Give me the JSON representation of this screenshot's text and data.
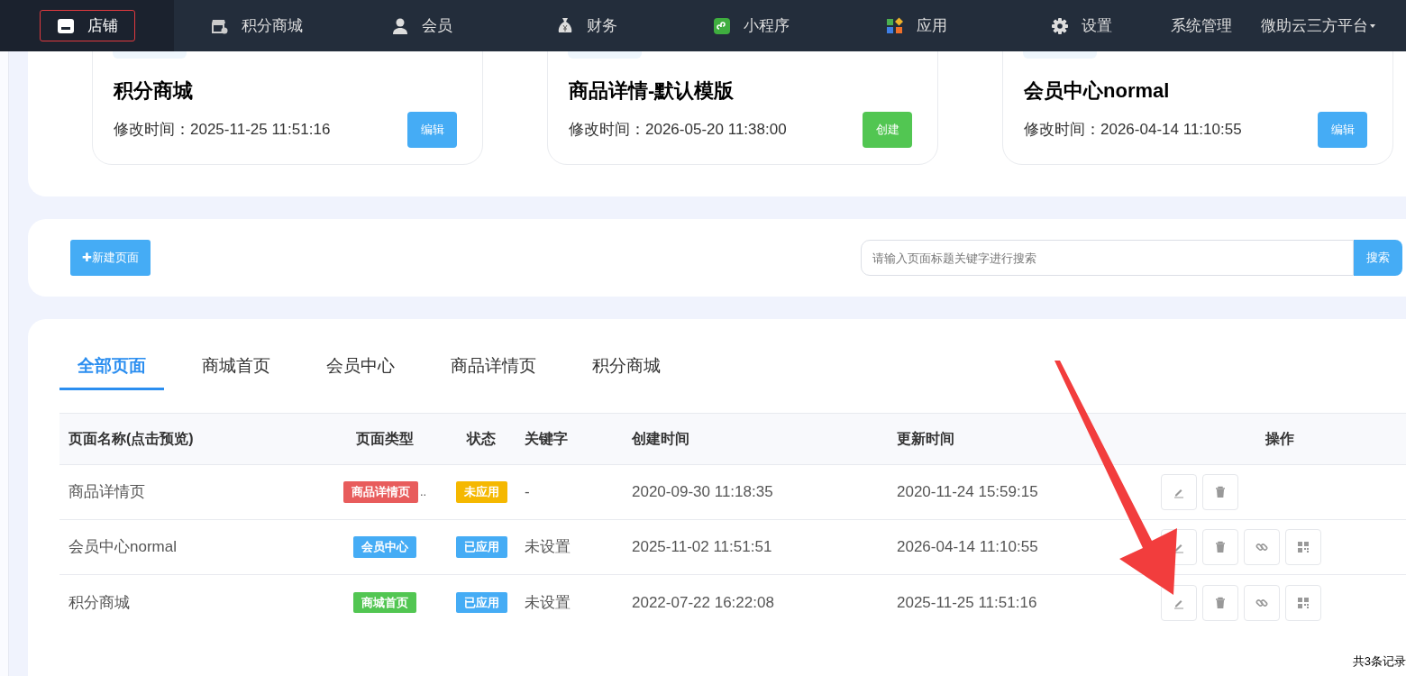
{
  "nav": {
    "items": [
      {
        "label": "店铺",
        "selected": true
      },
      {
        "label": "积分商城",
        "selected": false
      },
      {
        "label": "会员",
        "selected": false
      },
      {
        "label": "财务",
        "selected": false
      },
      {
        "label": "小程序",
        "selected": false
      },
      {
        "label": "应用",
        "selected": false
      },
      {
        "label": "设置",
        "selected": false
      }
    ],
    "links": [
      {
        "label": "系统管理",
        "dropdown": false
      },
      {
        "label": "微助云三方平台",
        "dropdown": true
      }
    ]
  },
  "templates": [
    {
      "title": "积分商城",
      "modified": "修改时间：2025-11-25 11:51:16",
      "action": "编辑",
      "kind": "edit"
    },
    {
      "title": "商品详情-默认模版",
      "modified": "修改时间：2026-05-20 11:38:00",
      "action": "创建",
      "kind": "create"
    },
    {
      "title": "会员中心normal",
      "modified": "修改时间：2026-04-14 11:10:55",
      "action": "编辑",
      "kind": "edit"
    }
  ],
  "toolbar": {
    "new_button": "✚新建页面",
    "search": {
      "placeholder": "请输入页面标题关键字进行搜索"
    },
    "search_button": "搜索"
  },
  "tabs": [
    {
      "label": "全部页面",
      "selected": true
    },
    {
      "label": "商城首页",
      "selected": false
    },
    {
      "label": "会员中心",
      "selected": false
    },
    {
      "label": "商品详情页",
      "selected": false
    },
    {
      "label": "积分商城",
      "selected": false
    }
  ],
  "table": {
    "columns": [
      "页面名称(点击预览)",
      "页面类型",
      "状态",
      "关键字",
      "创建时间",
      "更新时间",
      "操作"
    ],
    "rows": [
      {
        "name": "商品详情页",
        "type": "商品详情页",
        "color": "#e85c5c",
        "type_overflow": "..",
        "status": "未应用",
        "applied": false,
        "keyword": "-",
        "created": "2020-09-30 11:18:35",
        "updated": "2020-11-24 15:59:15",
        "actions": [
          {
            "kind": "edit"
          },
          {
            "kind": "delete"
          }
        ]
      },
      {
        "name": "会员中心normal",
        "type": "会员中心",
        "color": "#45acf5",
        "status": "已应用",
        "applied": true,
        "keyword": "未设置",
        "created": "2025-11-02 11:51:51",
        "updated": "2026-04-14 11:10:55",
        "actions": [
          {
            "kind": "edit"
          },
          {
            "kind": "delete"
          },
          {
            "kind": "link"
          },
          {
            "kind": "qrcode"
          }
        ]
      },
      {
        "name": "积分商城",
        "type": "商城首页",
        "color": "#52c652",
        "status": "已应用",
        "applied": true,
        "keyword": "未设置",
        "created": "2022-07-22 16:22:08",
        "updated": "2025-11-25 11:51:16",
        "actions": [
          {
            "kind": "edit"
          },
          {
            "kind": "delete"
          },
          {
            "kind": "link"
          },
          {
            "kind": "qrcode"
          }
        ]
      }
    ]
  },
  "footer": {
    "total": "共3条记录"
  }
}
